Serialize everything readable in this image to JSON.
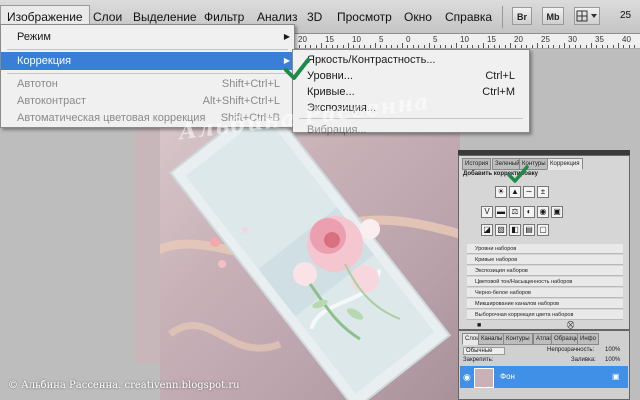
{
  "menubar": {
    "items": [
      "Изображение",
      "Слои",
      "Выделение",
      "Фильтр",
      "Анализ",
      "3D",
      "Просмотр",
      "Окно",
      "Справка"
    ],
    "buttons": [
      "Br",
      "Mb"
    ],
    "zoom": "25"
  },
  "ruler": {
    "ticks": [
      "20",
      "15",
      "10",
      "5",
      "0",
      "5",
      "10",
      "15",
      "20",
      "25",
      "30",
      "35",
      "40"
    ]
  },
  "image_menu": {
    "items": [
      {
        "label": "Режим",
        "shortcut": "",
        "submenu": true,
        "state": "normal"
      },
      {
        "label": "Коррекция",
        "shortcut": "",
        "submenu": true,
        "state": "highlighted"
      },
      {
        "label": "Автотон",
        "shortcut": "Shift+Ctrl+L",
        "submenu": false,
        "state": "disabled"
      },
      {
        "label": "Автоконтраст",
        "shortcut": "Alt+Shift+Ctrl+L",
        "submenu": false,
        "state": "disabled"
      },
      {
        "label": "Автоматическая цветовая коррекция",
        "shortcut": "Shift+Ctrl+B",
        "submenu": false,
        "state": "disabled"
      }
    ]
  },
  "correction_submenu": {
    "items": [
      {
        "label": "Яркость/Контрастность...",
        "shortcut": ""
      },
      {
        "label": "Уровни...",
        "shortcut": "Ctrl+L"
      },
      {
        "label": "Кривые...",
        "shortcut": "Ctrl+M"
      },
      {
        "label": "Экспозиция...",
        "shortcut": ""
      },
      {
        "label": "Вибрация...",
        "shortcut": ""
      }
    ]
  },
  "adjustments_panel": {
    "tabs": [
      "История",
      "Зеленый",
      "Контуры",
      "Коррекция"
    ],
    "heading": "Добавить корректировку",
    "presets": [
      "Уровни наборов",
      "Кривые наборов",
      "Экспозиция наборов",
      "Цветовой тон/Насыщенность наборов",
      "Черно-белое наборов",
      "Микширование каналов наборов",
      "Выборочная коррекция цвета наборов"
    ]
  },
  "layers_panel": {
    "tabs": [
      "Слои",
      "Каналы",
      "Контуры",
      "Атлас",
      "Образцы",
      "Инфо"
    ],
    "blend_mode": "Обычные",
    "opacity_label": "Непрозрачность:",
    "opacity": "100%",
    "lock_label": "Закрепить:",
    "fill_label": "Заливка:",
    "fill": "100%",
    "layer_name": "Фон"
  },
  "watermark": "Альбина Рассенна",
  "credit": "© Альбина Рассенна. creativenn.blogspot.ru",
  "colors": {
    "highlight": "#3a7ed8",
    "check": "#1f8a4c",
    "layer_selected": "#3f90e6"
  }
}
